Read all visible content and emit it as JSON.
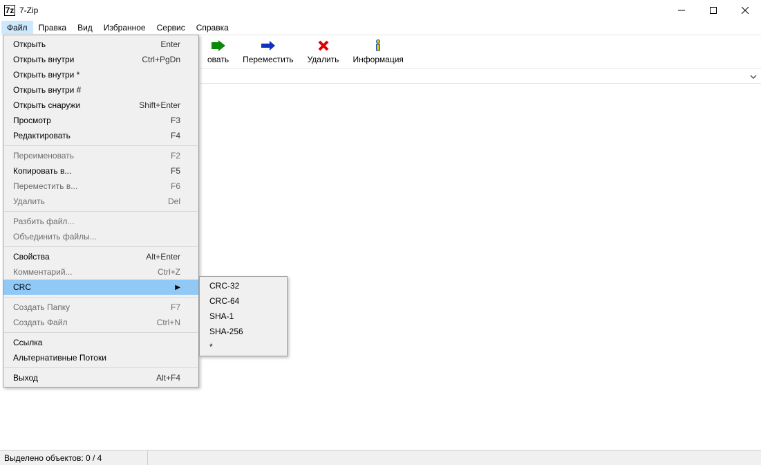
{
  "window": {
    "title": "7-Zip",
    "icon_text": "7z"
  },
  "menubar": [
    "Файл",
    "Правка",
    "Вид",
    "Избранное",
    "Сервис",
    "Справка"
  ],
  "toolbar": [
    {
      "key": "copy",
      "label": "овать"
    },
    {
      "key": "move",
      "label": "Переместить"
    },
    {
      "key": "delete",
      "label": "Удалить"
    },
    {
      "key": "info",
      "label": "Информация"
    }
  ],
  "file_menu": [
    {
      "t": "item",
      "label": "Открыть",
      "shortcut": "Enter"
    },
    {
      "t": "item",
      "label": "Открыть внутри",
      "shortcut": "Ctrl+PgDn"
    },
    {
      "t": "item",
      "label": "Открыть внутри *",
      "shortcut": ""
    },
    {
      "t": "item",
      "label": "Открыть внутри #",
      "shortcut": ""
    },
    {
      "t": "item",
      "label": "Открыть снаружи",
      "shortcut": "Shift+Enter"
    },
    {
      "t": "item",
      "label": "Просмотр",
      "shortcut": "F3"
    },
    {
      "t": "item",
      "label": "Редактировать",
      "shortcut": "F4"
    },
    {
      "t": "sep"
    },
    {
      "t": "item",
      "label": "Переименовать",
      "shortcut": "F2",
      "disabled": true
    },
    {
      "t": "item",
      "label": "Копировать в...",
      "shortcut": "F5"
    },
    {
      "t": "item",
      "label": "Переместить в...",
      "shortcut": "F6",
      "disabled": true
    },
    {
      "t": "item",
      "label": "Удалить",
      "shortcut": "Del",
      "disabled": true
    },
    {
      "t": "sep"
    },
    {
      "t": "item",
      "label": "Разбить файл...",
      "shortcut": "",
      "disabled": true
    },
    {
      "t": "item",
      "label": "Объединить файлы...",
      "shortcut": "",
      "disabled": true
    },
    {
      "t": "sep"
    },
    {
      "t": "item",
      "label": "Свойства",
      "shortcut": "Alt+Enter"
    },
    {
      "t": "item",
      "label": "Комментарий...",
      "shortcut": "Ctrl+Z",
      "disabled": true
    },
    {
      "t": "item",
      "label": "CRC",
      "shortcut": "",
      "submenu": true,
      "hovered": true
    },
    {
      "t": "sep"
    },
    {
      "t": "item",
      "label": "Создать Папку",
      "shortcut": "F7",
      "disabled": true
    },
    {
      "t": "item",
      "label": "Создать Файл",
      "shortcut": "Ctrl+N",
      "disabled": true
    },
    {
      "t": "sep"
    },
    {
      "t": "item",
      "label": "Ссылка",
      "shortcut": ""
    },
    {
      "t": "item",
      "label": "Альтернативные Потоки",
      "shortcut": ""
    },
    {
      "t": "sep"
    },
    {
      "t": "item",
      "label": "Выход",
      "shortcut": "Alt+F4"
    }
  ],
  "crc_menu": [
    "CRC-32",
    "CRC-64",
    "SHA-1",
    "SHA-256",
    "*"
  ],
  "statusbar": {
    "selection": "Выделено объектов: 0 / 4"
  }
}
